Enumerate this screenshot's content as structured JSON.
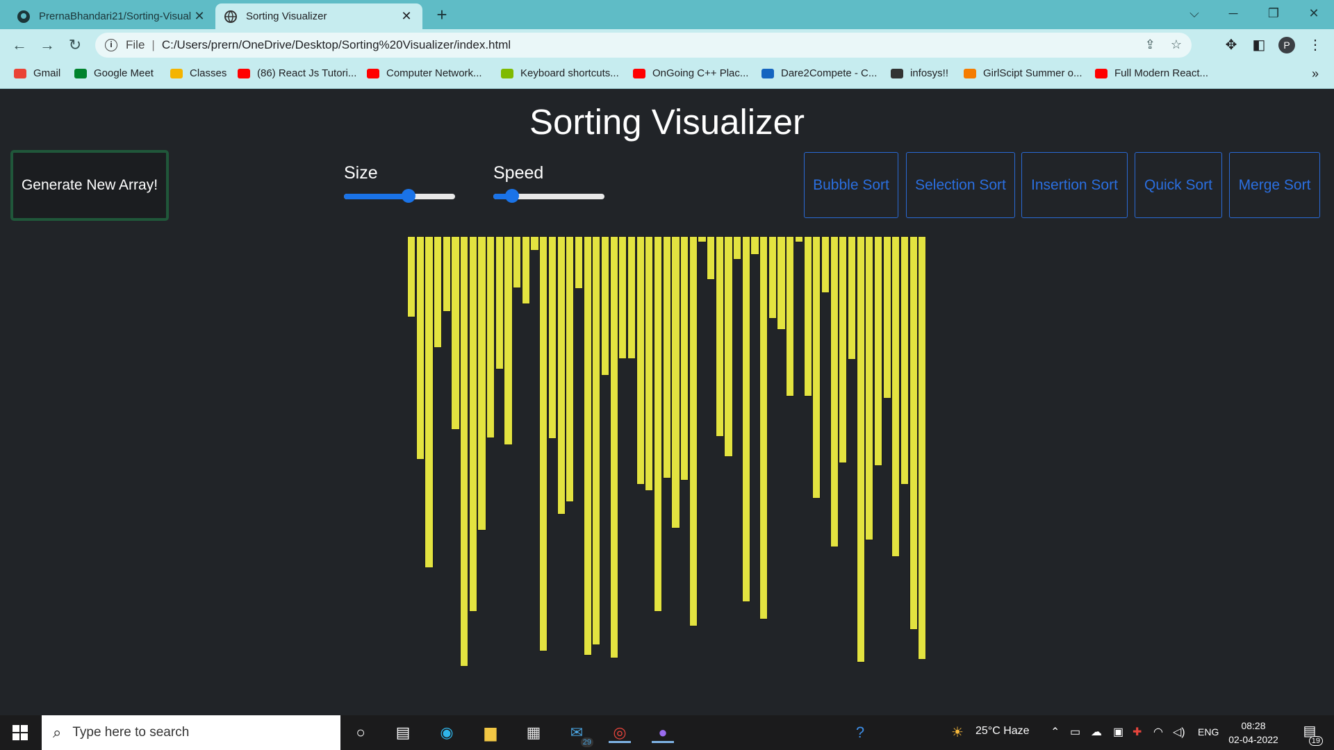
{
  "browser": {
    "tabs": [
      {
        "title": "PrernaBhandari21/Sorting-Visuali",
        "icon": "github-icon"
      },
      {
        "title": "Sorting Visualizer",
        "icon": "globe-icon"
      }
    ],
    "address": {
      "scheme_label": "File",
      "url": "C:/Users/prern/OneDrive/Desktop/Sorting%20Visualizer/index.html"
    },
    "profile_initial": "P",
    "bookmarks": [
      {
        "label": "Gmail",
        "color": "#ea4335"
      },
      {
        "label": "Google Meet",
        "color": "#00832d"
      },
      {
        "label": "Classes",
        "color": "#f4b400"
      },
      {
        "label": "(86) React Js Tutori...",
        "color": "#ff0000"
      },
      {
        "label": "Computer Network...",
        "color": "#ff0000"
      },
      {
        "label": "Keyboard shortcuts...",
        "color": "#7fba00"
      },
      {
        "label": "OnGoing C++ Plac...",
        "color": "#ff0000"
      },
      {
        "label": "Dare2Compete - C...",
        "color": "#1565c0"
      },
      {
        "label": "infosys!!",
        "color": "#333333"
      },
      {
        "label": "GirlScipt Summer o...",
        "color": "#f57c00"
      },
      {
        "label": "Full Modern React...",
        "color": "#ff0000"
      }
    ]
  },
  "page": {
    "title": "Sorting Visualizer",
    "generate_label": "Generate New Array!",
    "size_label": "Size",
    "speed_label": "Speed",
    "size_value": 0.58,
    "speed_value": 0.17,
    "algorithms": [
      "Bubble Sort",
      "Selection Sort",
      "Insertion Sort",
      "Quick Sort",
      "Merge Sort"
    ],
    "bar_color": "#e3e340",
    "bar_heights": [
      95,
      262,
      389,
      131,
      89,
      227,
      505,
      441,
      345,
      237,
      156,
      245,
      61,
      80,
      17,
      487,
      238,
      327,
      312,
      62,
      492,
      480,
      164,
      495,
      144,
      144,
      292,
      299,
      441,
      284,
      343,
      287,
      458,
      7,
      51,
      235,
      259,
      28,
      429,
      22,
      450,
      97,
      110,
      188,
      7,
      188,
      308,
      67,
      365,
      266,
      145,
      500,
      357,
      270,
      191,
      376,
      292,
      462,
      497
    ],
    "bar_max": 505
  },
  "taskbar": {
    "search_placeholder": "Type here to search",
    "mail_badge": "29",
    "weather": "25°C  Haze",
    "language": "ENG",
    "time": "08:28",
    "date": "02-04-2022",
    "notifications": "19"
  }
}
